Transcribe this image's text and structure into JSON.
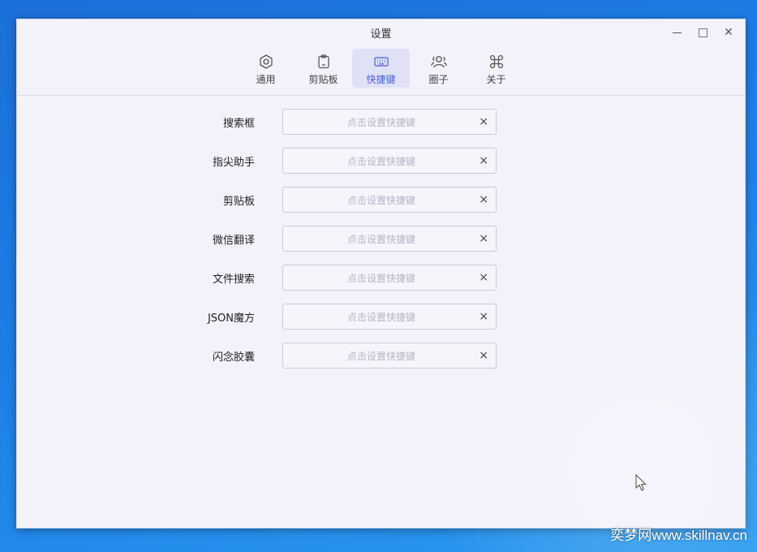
{
  "window": {
    "title": "设置",
    "controls": {
      "minimize": "minimize",
      "maximize": "maximize",
      "close": "✕"
    }
  },
  "tabs": [
    {
      "label": "通用",
      "icon": "hexagon-gear-icon",
      "active": false
    },
    {
      "label": "剪贴板",
      "icon": "clipboard-icon",
      "active": false
    },
    {
      "label": "快捷键",
      "icon": "keyboard-icon",
      "active": true
    },
    {
      "label": "圈子",
      "icon": "group-icon",
      "active": false
    },
    {
      "label": "关于",
      "icon": "command-icon",
      "active": false
    }
  ],
  "shortcuts": {
    "placeholder": "点击设置快捷键",
    "clear_icon": "×",
    "rows": [
      {
        "label": "搜索框"
      },
      {
        "label": "指尖助手"
      },
      {
        "label": "剪贴板"
      },
      {
        "label": "微信翻译"
      },
      {
        "label": "文件搜索"
      },
      {
        "label": "JSON魔方"
      },
      {
        "label": "闪念胶囊"
      }
    ]
  },
  "watermark": "奕梦网www.skillnav.cn",
  "colors": {
    "accent": "#4a5fd4",
    "active_tab_bg": "#dfe2f7",
    "window_bg": "#f3f2fb",
    "desktop": "#1d7fe6"
  }
}
